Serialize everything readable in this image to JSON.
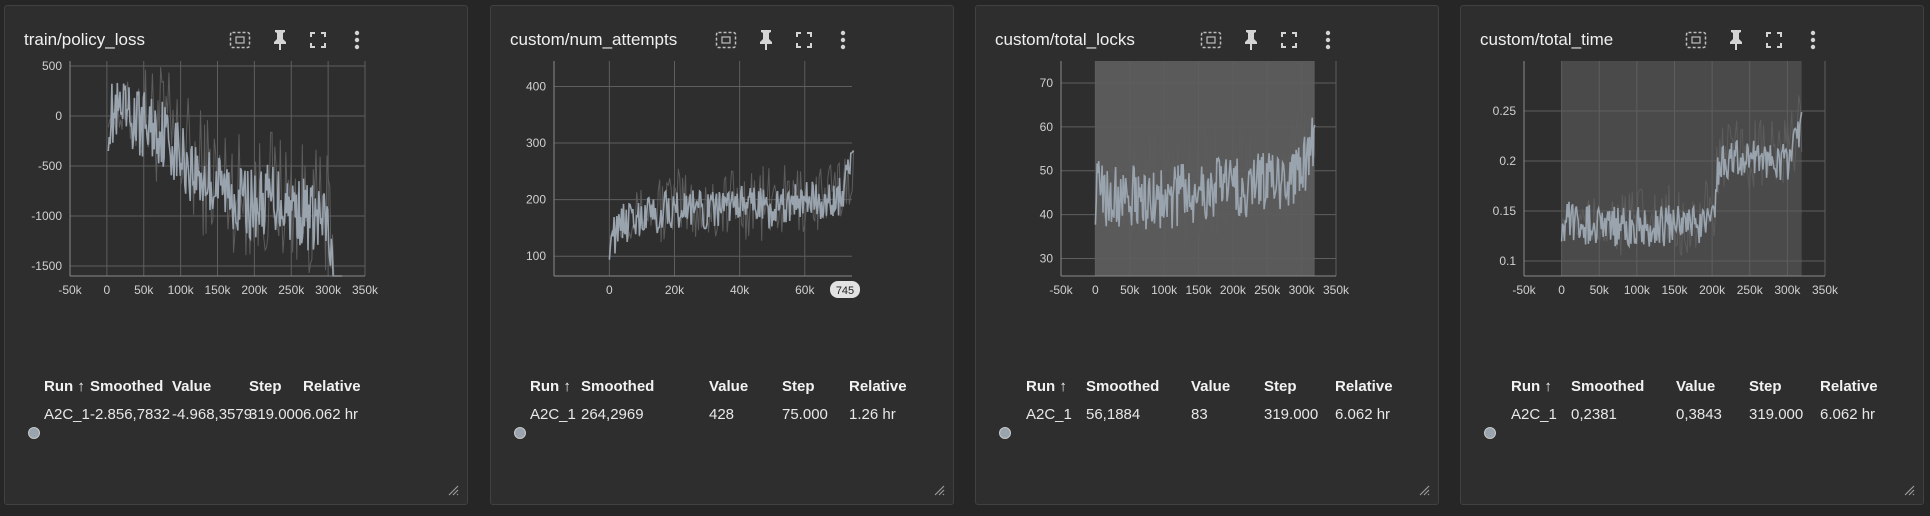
{
  "panels": [
    {
      "title": "train/policy_loss",
      "table": {
        "headers": {
          "run": "Run ↑",
          "smoothed": "Smoothed",
          "value": "Value",
          "step": "Step",
          "relative": "Relative"
        },
        "row": {
          "run": "A2C_1",
          "smoothed": "-2.856,7832",
          "value": "-4.968,3579",
          "step": "319.000",
          "relative": "6.062 hr"
        }
      }
    },
    {
      "title": "custom/num_attempts",
      "table": {
        "headers": {
          "run": "Run ↑",
          "smoothed": "Smoothed",
          "value": "Value",
          "step": "Step",
          "relative": "Relative"
        },
        "row": {
          "run": "A2C_1",
          "smoothed": "264,2969",
          "value": "428",
          "step": "75.000",
          "relative": "1.26 hr"
        }
      }
    },
    {
      "title": "custom/total_locks",
      "table": {
        "headers": {
          "run": "Run ↑",
          "smoothed": "Smoothed",
          "value": "Value",
          "step": "Step",
          "relative": "Relative"
        },
        "row": {
          "run": "A2C_1",
          "smoothed": "56,1884",
          "value": "83",
          "step": "319.000",
          "relative": "6.062 hr"
        }
      }
    },
    {
      "title": "custom/total_time",
      "table": {
        "headers": {
          "run": "Run ↑",
          "smoothed": "Smoothed",
          "value": "Value",
          "step": "Step",
          "relative": "Relative"
        },
        "row": {
          "run": "A2C_1",
          "smoothed": "0,2381",
          "value": "0,3843",
          "step": "319.000",
          "relative": "6.062 hr"
        }
      }
    }
  ],
  "icons": [
    "fit-domain-icon",
    "pin-icon",
    "fullscreen-icon",
    "more-vert-icon"
  ],
  "colors": {
    "smoothed": "#9aa4ae",
    "raw": "#5c5c5c",
    "hover_pill": "#e2e2e2"
  },
  "chart_data": [
    {
      "type": "line",
      "title": "train/policy_loss",
      "xlim": [
        -50000,
        350000
      ],
      "ylim": [
        -1600,
        550
      ],
      "xticks": [
        -50000,
        0,
        50000,
        100000,
        150000,
        200000,
        250000,
        300000,
        350000
      ],
      "xtick_labels": [
        "-50k",
        "0",
        "50k",
        "100k",
        "150k",
        "200k",
        "250k",
        "300k",
        "350k"
      ],
      "yticks": [
        500,
        0,
        -500,
        -1000,
        -1500
      ],
      "ytick_labels": [
        "500",
        "0",
        "-500",
        "-1000",
        "-1500"
      ],
      "series": [
        {
          "values_kind": "smoothed",
          "x": [
            2000,
            25000,
            50000,
            75000,
            100000,
            125000,
            150000,
            175000,
            200000,
            225000,
            250000,
            275000,
            300000,
            319000
          ],
          "y": [
            0,
            -20,
            -80,
            -150,
            -400,
            -600,
            -700,
            -800,
            -900,
            -800,
            -900,
            -1000,
            -1100,
            -2856.7832
          ]
        }
      ],
      "last_value": -4968.3579,
      "last_step": 319000,
      "grid": true
    },
    {
      "type": "line",
      "title": "custom/num_attempts",
      "xlim": [
        -17000,
        74500
      ],
      "ylim": [
        65,
        445
      ],
      "xticks": [
        0,
        20000,
        40000,
        60000
      ],
      "xtick_labels": [
        "0",
        "20k",
        "40k",
        "60k"
      ],
      "yticks": [
        100,
        200,
        300,
        400
      ],
      "ytick_labels": [
        "100",
        "200",
        "300",
        "400"
      ],
      "series": [
        {
          "values_kind": "smoothed",
          "x": [
            0,
            5000,
            10000,
            20000,
            30000,
            40000,
            50000,
            60000,
            70000,
            75000
          ],
          "y": [
            130,
            160,
            170,
            185,
            180,
            190,
            185,
            195,
            200,
            264.2969
          ]
        }
      ],
      "last_value": 428,
      "last_step": 75000,
      "hover_label": "745",
      "grid": true
    },
    {
      "type": "line",
      "title": "custom/total_locks",
      "xlim": [
        -50000,
        350000
      ],
      "ylim": [
        26,
        75
      ],
      "xticks": [
        -50000,
        0,
        50000,
        100000,
        150000,
        200000,
        250000,
        300000,
        350000
      ],
      "xtick_labels": [
        "-50k",
        "0",
        "50k",
        "100k",
        "150k",
        "200k",
        "250k",
        "300k",
        "350k"
      ],
      "yticks": [
        30,
        40,
        50,
        60,
        70
      ],
      "ytick_labels": [
        "30",
        "40",
        "50",
        "60",
        "70"
      ],
      "series": [
        {
          "values_kind": "smoothed",
          "x": [
            0,
            50000,
            100000,
            150000,
            200000,
            250000,
            300000,
            319000
          ],
          "y": [
            45,
            44,
            44,
            45,
            46,
            48,
            49,
            56.1884
          ]
        }
      ],
      "last_value": 83,
      "last_step": 319000,
      "grid": true
    },
    {
      "type": "line",
      "title": "custom/total_time",
      "xlim": [
        -50000,
        350000
      ],
      "ylim": [
        0.085,
        0.3
      ],
      "xticks": [
        -50000,
        0,
        50000,
        100000,
        150000,
        200000,
        250000,
        300000,
        350000
      ],
      "xtick_labels": [
        "-50k",
        "0",
        "50k",
        "100k",
        "150k",
        "200k",
        "250k",
        "300k",
        "350k"
      ],
      "yticks": [
        0.1,
        0.15,
        0.2,
        0.25
      ],
      "ytick_labels": [
        "0.1",
        "0.15",
        "0.2",
        "0.25"
      ],
      "series": [
        {
          "values_kind": "smoothed",
          "x": [
            0,
            50000,
            100000,
            150000,
            200000,
            210000,
            250000,
            300000,
            319000
          ],
          "y": [
            0.14,
            0.135,
            0.135,
            0.135,
            0.14,
            0.2,
            0.2,
            0.2,
            0.2381
          ]
        }
      ],
      "last_value": 0.3843,
      "last_step": 319000,
      "grid": true
    }
  ]
}
